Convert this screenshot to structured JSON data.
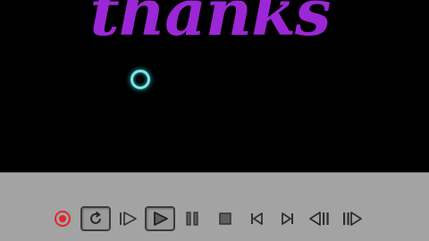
{
  "viewport": {
    "title_text": "thanks",
    "title_color": "#9b27d6",
    "spinner_color": "#7fe3e8"
  },
  "controls": {
    "accent_record": "#e0262c",
    "buttons": [
      {
        "icon": "record-icon",
        "state": "normal"
      },
      {
        "icon": "loop-icon",
        "state": "pressed"
      },
      {
        "icon": "slow-play-icon",
        "state": "normal"
      },
      {
        "icon": "play-icon",
        "state": "pressed"
      },
      {
        "icon": "pause-icon",
        "state": "normal"
      },
      {
        "icon": "stop-icon",
        "state": "normal"
      },
      {
        "icon": "skip-back-icon",
        "state": "normal"
      },
      {
        "icon": "skip-forward-icon",
        "state": "normal"
      },
      {
        "icon": "step-back-icon",
        "state": "normal"
      },
      {
        "icon": "step-forward-icon",
        "state": "normal"
      }
    ]
  }
}
